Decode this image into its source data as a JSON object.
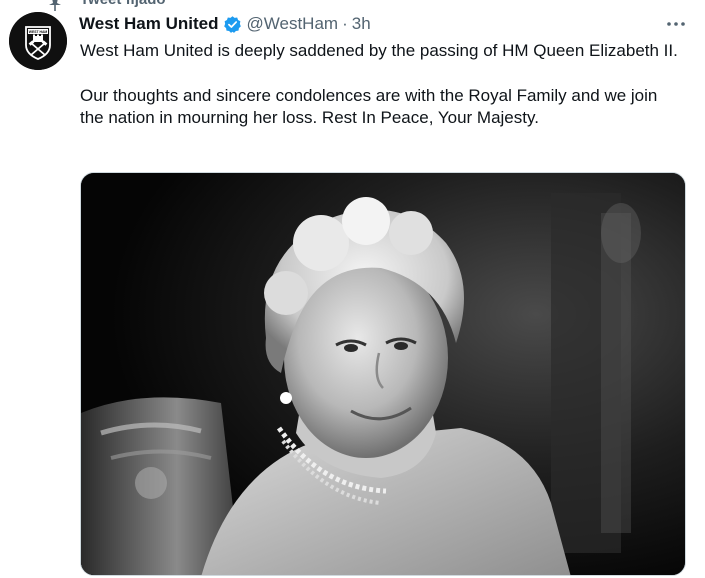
{
  "pinned": {
    "label": "Tweet fijado"
  },
  "tweet": {
    "display_name": "West Ham United",
    "handle": "@WestHam",
    "separator": "·",
    "time": "3h",
    "text_paragraphs": [
      "West Ham United is deeply saddened by the passing of HM Queen Elizabeth II.",
      "Our thoughts and sincere condolences are with the Royal Family and we join the nation in mourning her loss. Rest In Peace, Your Majesty."
    ],
    "avatar_icon": "west-ham-crest",
    "verified_icon": "verified-badge-icon",
    "more_icon": "more-options-icon",
    "media_icon": "black-and-white-portrait-photo"
  },
  "colors": {
    "text_primary": "#0f1419",
    "text_secondary": "#536471",
    "verified_blue": "#1d9bf0",
    "border": "#cfd9de",
    "avatar_bg": "#101010"
  }
}
